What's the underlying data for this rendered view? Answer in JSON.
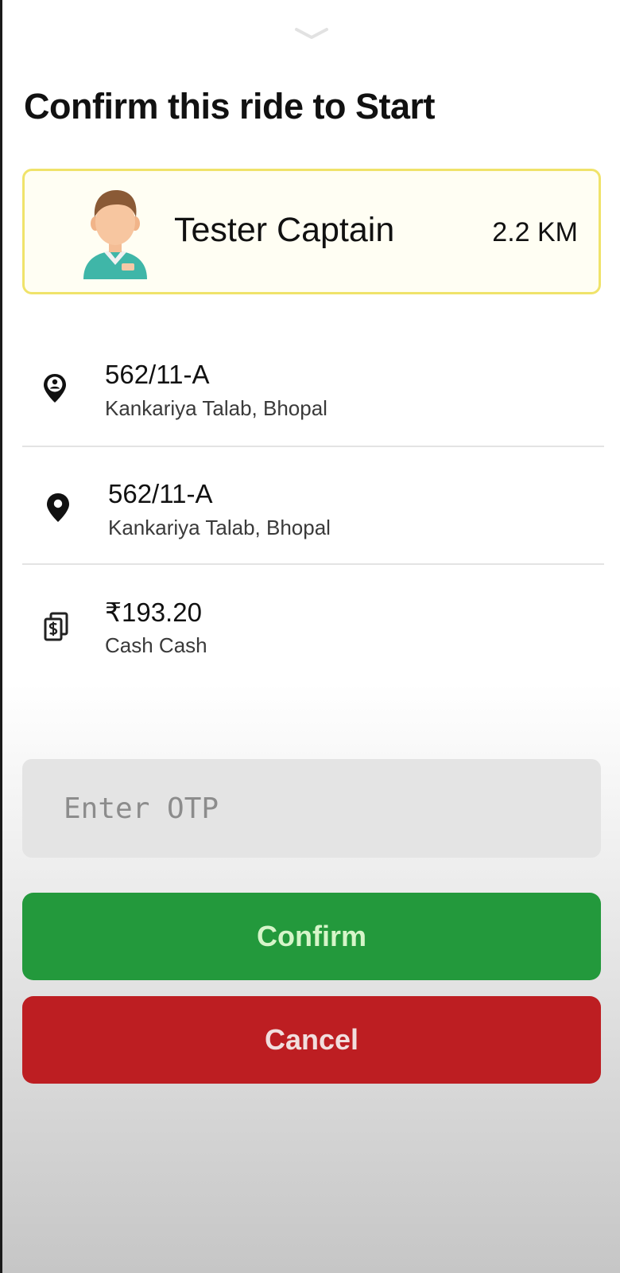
{
  "title": "Confirm this ride to Start",
  "captain": {
    "name": "Tester Captain",
    "distance": "2.2 KM",
    "avatar_icon": "captain-avatar-icon"
  },
  "pickup": {
    "icon": "pickup-location-icon",
    "address": "562/11-A",
    "locality": "Kankariya Talab, Bhopal"
  },
  "drop": {
    "icon": "drop-location-pin-icon",
    "address": "562/11-A",
    "locality": "Kankariya Talab, Bhopal"
  },
  "payment": {
    "icon": "cash-icon",
    "amount": "₹193.20",
    "method": "Cash Cash"
  },
  "otp": {
    "placeholder": "Enter OTP",
    "value": ""
  },
  "actions": {
    "confirm_label": "Confirm",
    "cancel_label": "Cancel"
  },
  "colors": {
    "card_border": "#f0e36a",
    "confirm": "#23993c",
    "cancel": "#bd1e22",
    "otp_background": "#e4e4e4"
  }
}
